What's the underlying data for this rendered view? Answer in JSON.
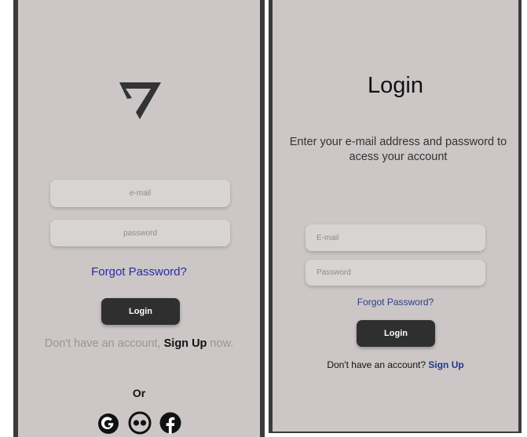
{
  "left": {
    "logo_icon": "triangle-check-logo",
    "email_placeholder": "e-mail",
    "password_placeholder": "password",
    "forgot_password": "Forgot Password?",
    "login_label": "Login",
    "signup_prefix": "Don't have an account, ",
    "signup_link": "Sign Up",
    "signup_suffix": " now.",
    "or_label": "Or",
    "social_icons": [
      "google-icon",
      "flickr-icon",
      "facebook-icon"
    ]
  },
  "right": {
    "title": "Login",
    "subtitle": "Enter your e-mail address and password to acess your account",
    "email_placeholder": "E-mail",
    "password_placeholder": "Password",
    "forgot_password": "Forgot Password?",
    "login_label": "Login",
    "signup_prefix": "Don't have an account? ",
    "signup_link": "Sign Up"
  },
  "colors": {
    "screen_bg": "#ccc6c6",
    "frame": "#3b3b3b",
    "button_bg": "#2f2f2f",
    "link_blue": "#2a2aa8"
  }
}
